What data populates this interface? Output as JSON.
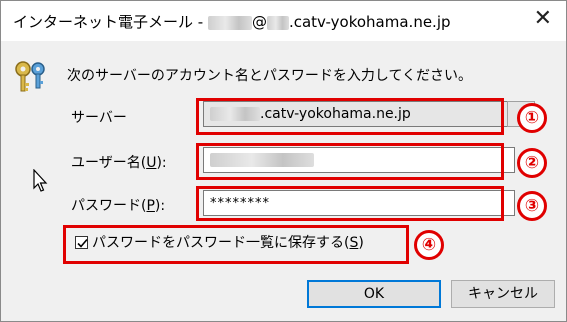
{
  "window": {
    "title_prefix": "インターネット電子メール - ",
    "title_at": "@",
    "title_domain": ".catv-yokohama.ne.jp",
    "close_glyph": "✕"
  },
  "prompt": "次のサーバーのアカウント名とパスワードを入力してください。",
  "server": {
    "label": "サーバー",
    "value_domain": ".catv-yokohama.ne.jp"
  },
  "user": {
    "label_text": "ユーザー名(",
    "label_key": "U",
    "label_end": "):"
  },
  "password": {
    "label_text": "パスワード(",
    "label_key": "P",
    "label_end": "):",
    "value": "********"
  },
  "save_password": {
    "checked": true,
    "label_text": "パスワードをパスワード一覧に保存する(",
    "label_key": "S",
    "label_end": ")"
  },
  "buttons": {
    "ok": "OK",
    "cancel": "キャンセル"
  },
  "annotations": [
    "①",
    "②",
    "③",
    "④"
  ],
  "colors": {
    "annotation_red": "#e00000",
    "default_button_border": "#0078d7"
  },
  "icons": {
    "keys": "keys-icon",
    "close": "close-icon",
    "cursor": "mouse-cursor-icon",
    "check": "check-icon"
  }
}
